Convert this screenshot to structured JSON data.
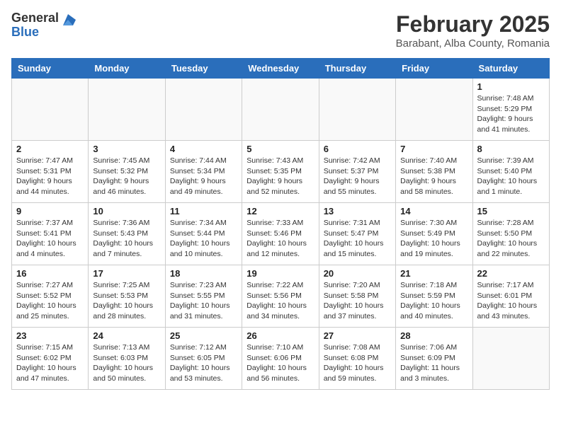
{
  "header": {
    "logo_general": "General",
    "logo_blue": "Blue",
    "month_year": "February 2025",
    "location": "Barabant, Alba County, Romania"
  },
  "days_of_week": [
    "Sunday",
    "Monday",
    "Tuesday",
    "Wednesday",
    "Thursday",
    "Friday",
    "Saturday"
  ],
  "weeks": [
    [
      {
        "day": "",
        "info": ""
      },
      {
        "day": "",
        "info": ""
      },
      {
        "day": "",
        "info": ""
      },
      {
        "day": "",
        "info": ""
      },
      {
        "day": "",
        "info": ""
      },
      {
        "day": "",
        "info": ""
      },
      {
        "day": "1",
        "info": "Sunrise: 7:48 AM\nSunset: 5:29 PM\nDaylight: 9 hours\nand 41 minutes."
      }
    ],
    [
      {
        "day": "2",
        "info": "Sunrise: 7:47 AM\nSunset: 5:31 PM\nDaylight: 9 hours\nand 44 minutes."
      },
      {
        "day": "3",
        "info": "Sunrise: 7:45 AM\nSunset: 5:32 PM\nDaylight: 9 hours\nand 46 minutes."
      },
      {
        "day": "4",
        "info": "Sunrise: 7:44 AM\nSunset: 5:34 PM\nDaylight: 9 hours\nand 49 minutes."
      },
      {
        "day": "5",
        "info": "Sunrise: 7:43 AM\nSunset: 5:35 PM\nDaylight: 9 hours\nand 52 minutes."
      },
      {
        "day": "6",
        "info": "Sunrise: 7:42 AM\nSunset: 5:37 PM\nDaylight: 9 hours\nand 55 minutes."
      },
      {
        "day": "7",
        "info": "Sunrise: 7:40 AM\nSunset: 5:38 PM\nDaylight: 9 hours\nand 58 minutes."
      },
      {
        "day": "8",
        "info": "Sunrise: 7:39 AM\nSunset: 5:40 PM\nDaylight: 10 hours\nand 1 minute."
      }
    ],
    [
      {
        "day": "9",
        "info": "Sunrise: 7:37 AM\nSunset: 5:41 PM\nDaylight: 10 hours\nand 4 minutes."
      },
      {
        "day": "10",
        "info": "Sunrise: 7:36 AM\nSunset: 5:43 PM\nDaylight: 10 hours\nand 7 minutes."
      },
      {
        "day": "11",
        "info": "Sunrise: 7:34 AM\nSunset: 5:44 PM\nDaylight: 10 hours\nand 10 minutes."
      },
      {
        "day": "12",
        "info": "Sunrise: 7:33 AM\nSunset: 5:46 PM\nDaylight: 10 hours\nand 12 minutes."
      },
      {
        "day": "13",
        "info": "Sunrise: 7:31 AM\nSunset: 5:47 PM\nDaylight: 10 hours\nand 15 minutes."
      },
      {
        "day": "14",
        "info": "Sunrise: 7:30 AM\nSunset: 5:49 PM\nDaylight: 10 hours\nand 19 minutes."
      },
      {
        "day": "15",
        "info": "Sunrise: 7:28 AM\nSunset: 5:50 PM\nDaylight: 10 hours\nand 22 minutes."
      }
    ],
    [
      {
        "day": "16",
        "info": "Sunrise: 7:27 AM\nSunset: 5:52 PM\nDaylight: 10 hours\nand 25 minutes."
      },
      {
        "day": "17",
        "info": "Sunrise: 7:25 AM\nSunset: 5:53 PM\nDaylight: 10 hours\nand 28 minutes."
      },
      {
        "day": "18",
        "info": "Sunrise: 7:23 AM\nSunset: 5:55 PM\nDaylight: 10 hours\nand 31 minutes."
      },
      {
        "day": "19",
        "info": "Sunrise: 7:22 AM\nSunset: 5:56 PM\nDaylight: 10 hours\nand 34 minutes."
      },
      {
        "day": "20",
        "info": "Sunrise: 7:20 AM\nSunset: 5:58 PM\nDaylight: 10 hours\nand 37 minutes."
      },
      {
        "day": "21",
        "info": "Sunrise: 7:18 AM\nSunset: 5:59 PM\nDaylight: 10 hours\nand 40 minutes."
      },
      {
        "day": "22",
        "info": "Sunrise: 7:17 AM\nSunset: 6:01 PM\nDaylight: 10 hours\nand 43 minutes."
      }
    ],
    [
      {
        "day": "23",
        "info": "Sunrise: 7:15 AM\nSunset: 6:02 PM\nDaylight: 10 hours\nand 47 minutes."
      },
      {
        "day": "24",
        "info": "Sunrise: 7:13 AM\nSunset: 6:03 PM\nDaylight: 10 hours\nand 50 minutes."
      },
      {
        "day": "25",
        "info": "Sunrise: 7:12 AM\nSunset: 6:05 PM\nDaylight: 10 hours\nand 53 minutes."
      },
      {
        "day": "26",
        "info": "Sunrise: 7:10 AM\nSunset: 6:06 PM\nDaylight: 10 hours\nand 56 minutes."
      },
      {
        "day": "27",
        "info": "Sunrise: 7:08 AM\nSunset: 6:08 PM\nDaylight: 10 hours\nand 59 minutes."
      },
      {
        "day": "28",
        "info": "Sunrise: 7:06 AM\nSunset: 6:09 PM\nDaylight: 11 hours\nand 3 minutes."
      },
      {
        "day": "",
        "info": ""
      }
    ]
  ]
}
